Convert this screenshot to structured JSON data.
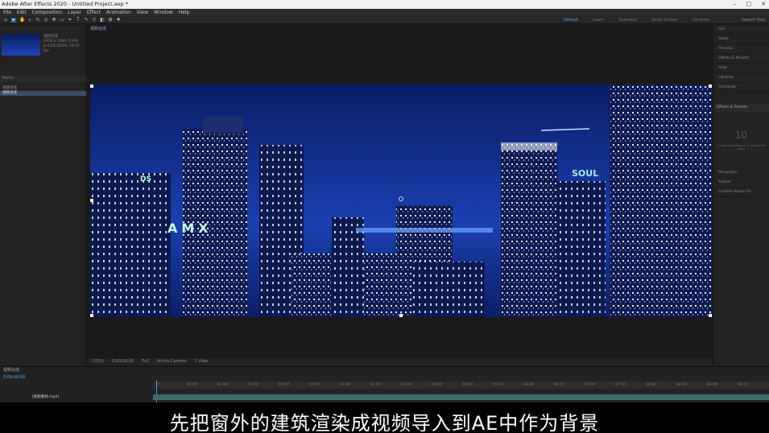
{
  "titlebar": {
    "title": "Adobe After Effects 2020 - Untitled Project.aep *"
  },
  "menu": [
    "File",
    "Edit",
    "Composition",
    "Layer",
    "Effect",
    "Animation",
    "View",
    "Window",
    "Help"
  ],
  "workspaces": {
    "default": "Default",
    "learn": "Learn",
    "standard": "Standard",
    "small": "Small Screen",
    "libraries": "Libraries"
  },
  "search_help": "Search Help",
  "project": {
    "item_name": "视频合成",
    "item_info": "1920 x 1080 (1.00)",
    "item_duration": "Δ 0;00;10;00, 29.97 fps",
    "column_header": "Name",
    "row_label": "视频合成",
    "selected_row_label": "视频合成"
  },
  "comp": {
    "tab_label": "视频合成",
    "viewer": {
      "signs": {
        "left_small": "DS",
        "amx": "AMX",
        "soul": "SOUL"
      }
    },
    "bottom_controls": {
      "zoom": "(53%)",
      "time": "0;00;00;00",
      "quality": "Full",
      "camera": "Active Camera",
      "views": "1 View"
    }
  },
  "right_panel": {
    "items": [
      "Info",
      "Audio",
      "Preview",
      "Effects & Presets",
      "Align",
      "Libraries",
      "Character"
    ],
    "header": "Effects & Presets",
    "preview_placeholder": "10",
    "preview_hint": "Choose a workspace to display the panel",
    "lower_items": [
      "Paragraph",
      "Tracker",
      "Content-Aware Fill"
    ]
  },
  "timeline": {
    "tab_label": "视频合成",
    "time": "0;00;00;00",
    "ticks": [
      "0f",
      "00:15f",
      "01:00f",
      "01:15f",
      "02:00f",
      "02:15f",
      "03:00f",
      "03:15f",
      "04:00f",
      "04:15f",
      "05:00f",
      "05:15f",
      "06:00f",
      "06:15f",
      "07:00f",
      "07:15f",
      "08:00f",
      "08:15f",
      "09:00f",
      "09:15f"
    ],
    "layer_name": "[视频素材.mp4]"
  },
  "subtitle": "先把窗外的建筑渲染成视频导入到AE中作为背景"
}
